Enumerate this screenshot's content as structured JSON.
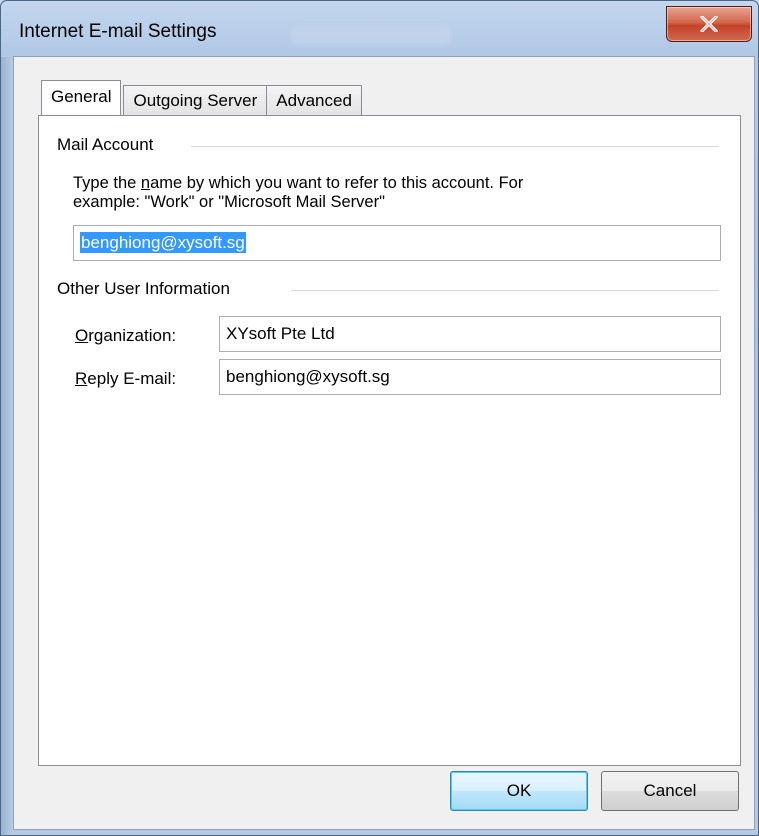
{
  "window": {
    "title": "Internet E-mail Settings",
    "close_glyph": "x"
  },
  "tabs": [
    {
      "label": "General",
      "active": true
    },
    {
      "label": "Outgoing Server",
      "active": false
    },
    {
      "label": "Advanced",
      "active": false
    }
  ],
  "mail_account": {
    "group_label": "Mail Account",
    "desc_part1": "Type the ",
    "desc_underlined": "n",
    "desc_part2": "ame by which you want to refer to this account. For",
    "desc_line2": "example: \"Work\" or \"Microsoft Mail Server\"",
    "account_name_value": "benghiong@xysoft.sg"
  },
  "other_user_info": {
    "group_label": "Other User Information",
    "organization_label": "Organization:",
    "organization_value": "XYsoft Pte Ltd",
    "reply_email_label": "Reply E-mail:",
    "reply_email_value": "benghiong@xysoft.sg"
  },
  "buttons": {
    "ok": "OK",
    "cancel": "Cancel"
  },
  "icons": {
    "close": "close-icon"
  },
  "colors": {
    "selection": "#3399ff",
    "close_button": "#c4422a",
    "frame": "#b2c9e6"
  }
}
